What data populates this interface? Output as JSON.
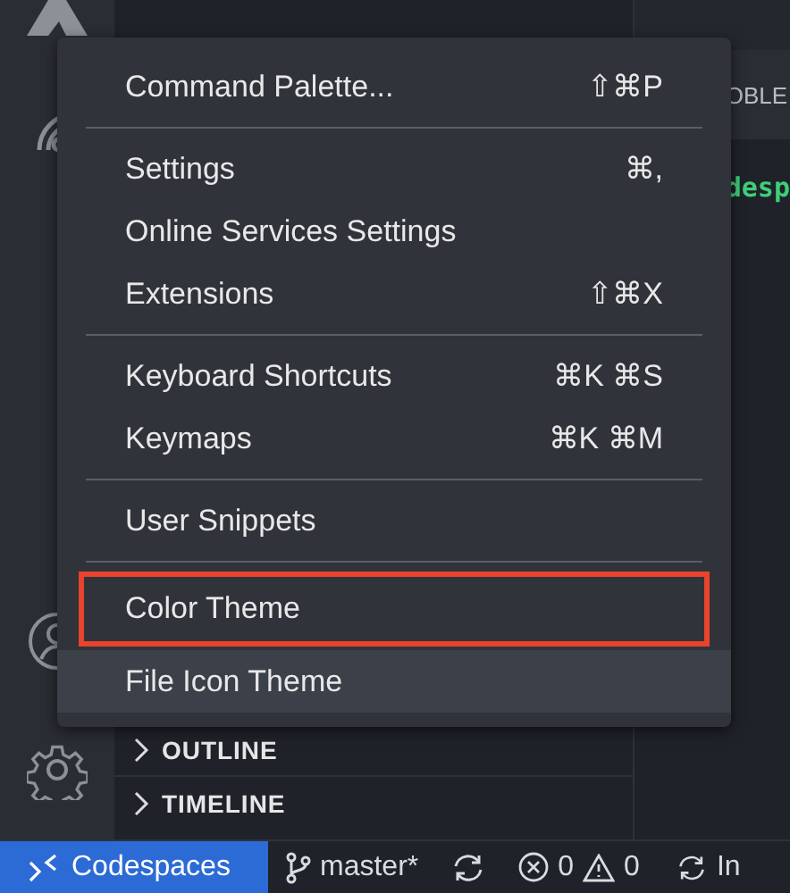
{
  "panel": {
    "tab_fragment": "OBLE",
    "code_fragment": "desp"
  },
  "sidebar": {
    "sections": [
      {
        "label": "OUTLINE",
        "expanded": false
      },
      {
        "label": "TIMELINE",
        "expanded": false
      }
    ]
  },
  "menu": {
    "groups": [
      [
        {
          "label": "Command Palette...",
          "shortcut": "⇧⌘P",
          "selected": false,
          "outlined": false
        }
      ],
      [
        {
          "label": "Settings",
          "shortcut": "⌘,",
          "selected": false,
          "outlined": false
        },
        {
          "label": "Online Services Settings",
          "selected": false,
          "outlined": false
        },
        {
          "label": "Extensions",
          "shortcut": "⇧⌘X",
          "selected": false,
          "outlined": false
        }
      ],
      [
        {
          "label": "Keyboard Shortcuts",
          "shortcut": "⌘K ⌘S",
          "selected": false,
          "outlined": false
        },
        {
          "label": "Keymaps",
          "shortcut": "⌘K ⌘M",
          "selected": false,
          "outlined": false
        }
      ],
      [
        {
          "label": "User Snippets",
          "selected": false,
          "outlined": false
        }
      ],
      [
        {
          "label": "Color Theme",
          "selected": false,
          "outlined": true
        },
        {
          "label": "File Icon Theme",
          "selected": true,
          "outlined": false
        }
      ]
    ]
  },
  "status_bar": {
    "remote": "Codespaces",
    "branch": "master*",
    "errors": "0",
    "warnings": "0",
    "activity": "In"
  }
}
